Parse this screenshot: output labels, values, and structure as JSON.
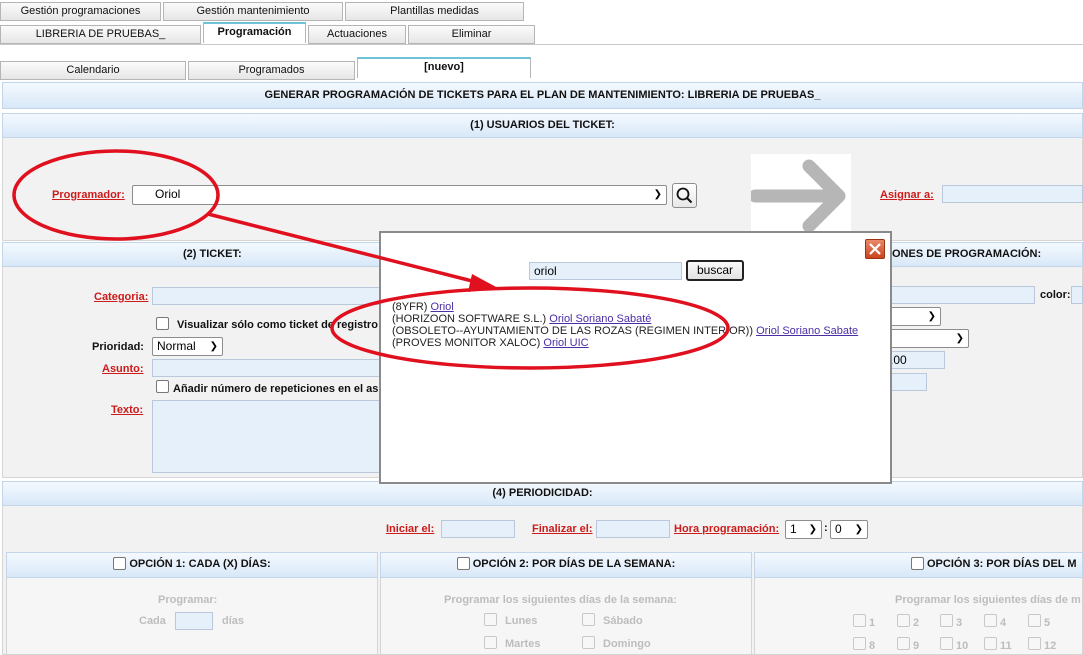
{
  "tabs_row1": [
    "Gestión programaciones",
    "Gestión mantenimiento",
    "Plantillas medidas"
  ],
  "tabs_row2": [
    "LIBRERIA DE PRUEBAS_",
    "Programación",
    "Actuaciones",
    "Eliminar"
  ],
  "tabs_row3": [
    "Calendario",
    "Programados",
    "[nuevo]"
  ],
  "header_title": "GENERAR PROGRAMACIÓN DE TICKETS PARA EL PLAN DE MANTENIMIENTO: LIBRERIA DE PRUEBAS_",
  "section1": {
    "title": "(1) USUARIOS DEL TICKET:",
    "programador_label": "Programador:",
    "programador_value": "Oriol",
    "asignar_label": "Asignar a:"
  },
  "section2": {
    "title": "(2) TICKET:",
    "categoria_label": "Categoria:",
    "visualizar_label": "Visualizar sólo como ticket de registro",
    "prioridad_label": "Prioridad:",
    "prioridad_value": "Normal",
    "asunto_label": "Asunto:",
    "repeticiones_label": "Añadir número de repeticiones en el asunto",
    "texto_label": "Texto:"
  },
  "section3": {
    "title": "ONES DE PROGRAMACIÓN:",
    "color_label": "color:",
    "amount": ".00"
  },
  "section4": {
    "title": "(4) PERIODICIDAD:",
    "iniciar_label": "Iniciar el:",
    "finalizar_label": "Finalizar el:",
    "hora_label": "Hora programación:",
    "hora_value": "1",
    "minuto_value": "0",
    "separator": ":"
  },
  "option1": {
    "title": "OPCIÓN 1: CADA (X) DÍAS:",
    "programar": "Programar:",
    "cada": "Cada",
    "dias": "días"
  },
  "option2": {
    "title": "OPCIÓN 2: POR DÍAS DE LA SEMANA:",
    "programar": "Programar los siguientes días de la semana:",
    "days": [
      "Lunes",
      "Sábado",
      "Martes",
      "Domingo"
    ]
  },
  "option3": {
    "title": "OPCIÓN 3: POR DÍAS DEL M",
    "programar": "Programar los siguientes días de m",
    "days": [
      "1",
      "2",
      "3",
      "4",
      "5",
      "8",
      "9",
      "10",
      "11",
      "12"
    ]
  },
  "popup": {
    "search_value": "oriol",
    "search_button": "buscar",
    "results": [
      {
        "prefix": "(8YFR)",
        "link": "Oriol"
      },
      {
        "prefix": "(HORIZOON SOFTWARE S.L.)",
        "link": "Oriol Soriano Sabaté"
      },
      {
        "prefix": "(OBSOLETO--AYUNTAMIENTO DE LAS ROZAS (REGIMEN INTERIOR))",
        "link": "Oriol Soriano Sabate"
      },
      {
        "prefix": "(PROVES MONITOR XALOC)",
        "link": "Oriol UIC"
      }
    ]
  },
  "colors": {
    "label_red": "#cc1b1b",
    "annotation_red": "#e0101e",
    "band_blue": "#d8e8f8",
    "input_blue": "#e6f0fb",
    "link_purple": "#4b2ea5"
  }
}
